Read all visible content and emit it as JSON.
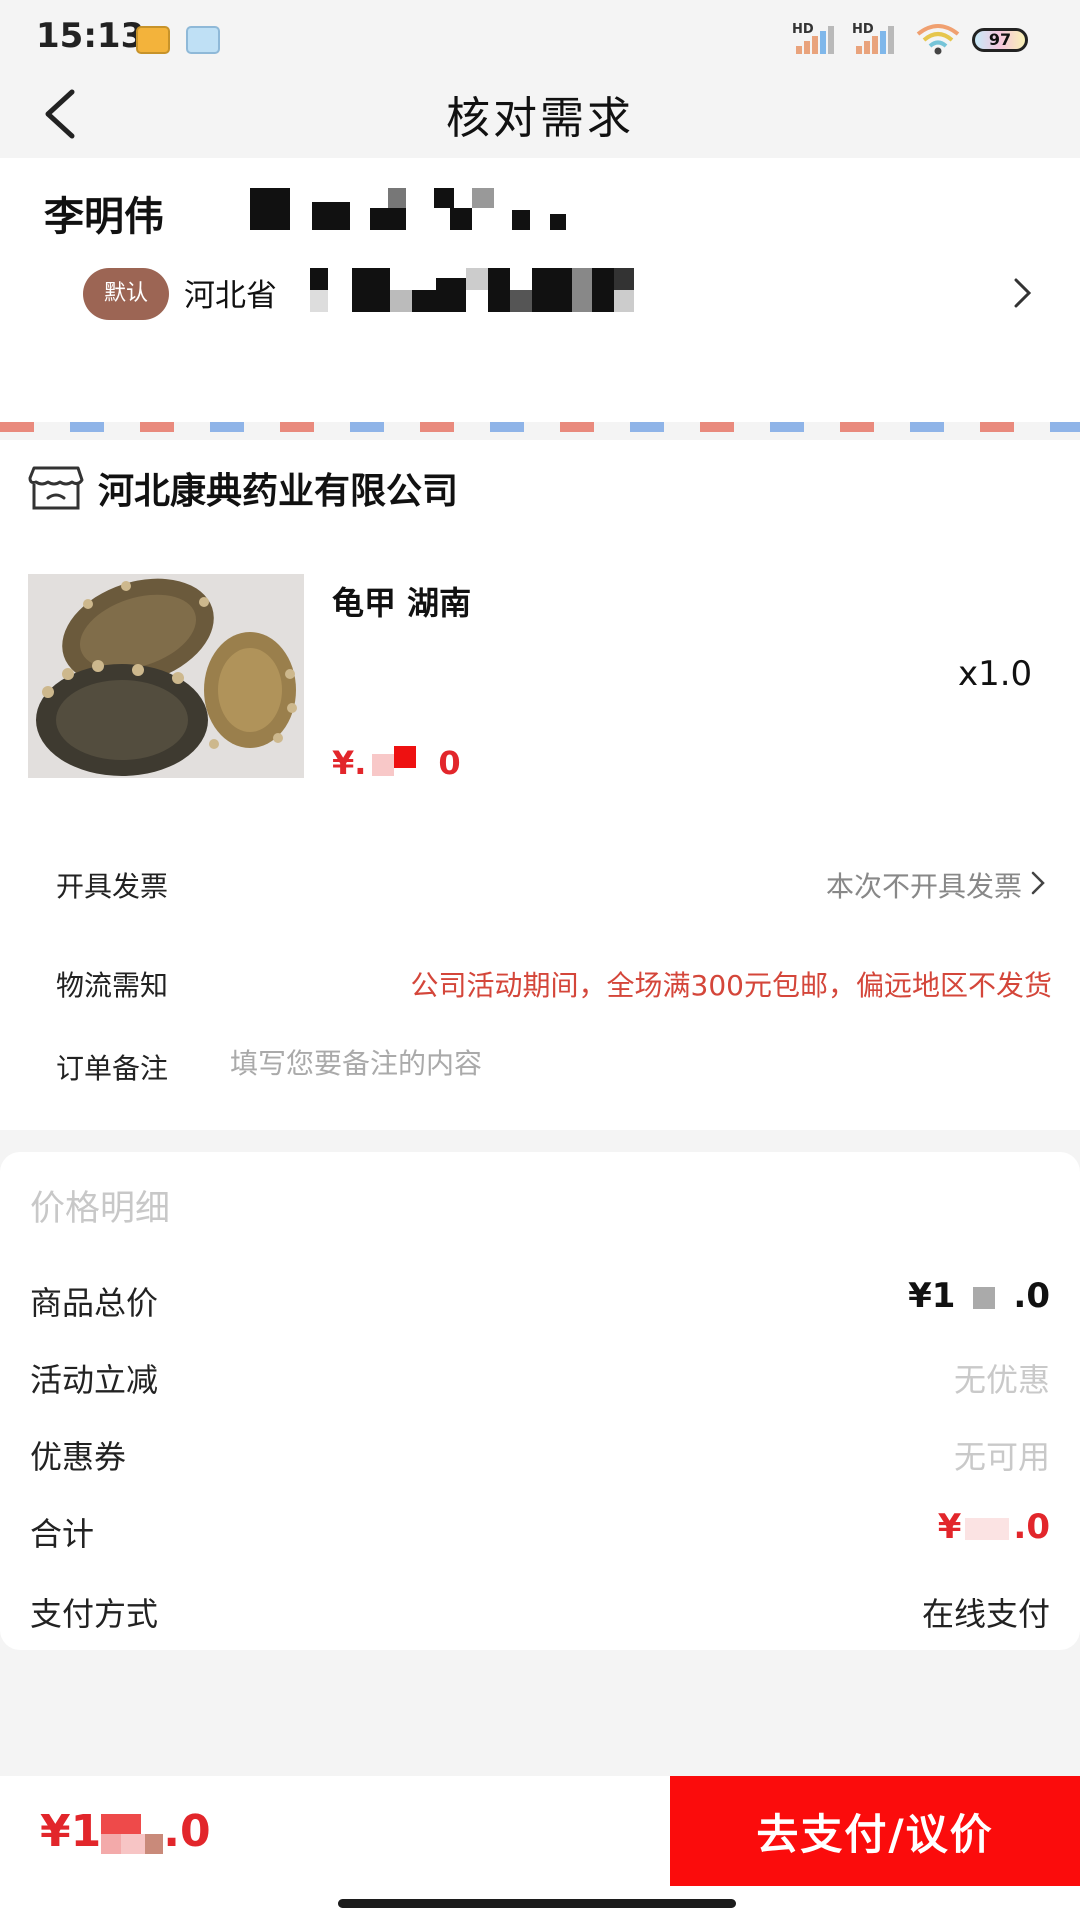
{
  "status_bar": {
    "time": "15:13",
    "signal_1": "HD",
    "signal_2": "HD",
    "battery": "97"
  },
  "header": {
    "title": "核对需求"
  },
  "address": {
    "name": "李明伟",
    "default_badge": "默认",
    "province": "河北省"
  },
  "store": {
    "name": "河北康典药业有限公司"
  },
  "product": {
    "name": "龟甲 湖南",
    "quantity": "x1.0",
    "price": "¥.",
    "price_tail": "0"
  },
  "order_rows": {
    "invoice_label": "开具发票",
    "invoice_value": "本次不开具发票",
    "logistics_label": "物流需知",
    "logistics_value": "公司活动期间，全场满300元包邮，偏远地区不发货",
    "remark_label": "订单备注",
    "remark_placeholder": "填写您要备注的内容"
  },
  "price_detail": {
    "heading": "价格明细",
    "goods_total_label": "商品总价",
    "goods_total_value_a": "¥1",
    "goods_total_value_b": ".0",
    "discount_label": "活动立减",
    "discount_value": "无优惠",
    "coupon_label": "优惠券",
    "coupon_value": "无可用",
    "sum_label": "合计",
    "sum_value_a": "¥",
    "sum_value_b": ".0",
    "payment_label": "支付方式",
    "payment_value": "在线支付"
  },
  "bottom_bar": {
    "total_a": "¥1",
    "total_b": ".0",
    "pay_button": "去支付/议价"
  },
  "colors": {
    "accent_red": "#fb0c0c",
    "price_red": "#e2262b",
    "badge_brown": "#9c6554"
  }
}
